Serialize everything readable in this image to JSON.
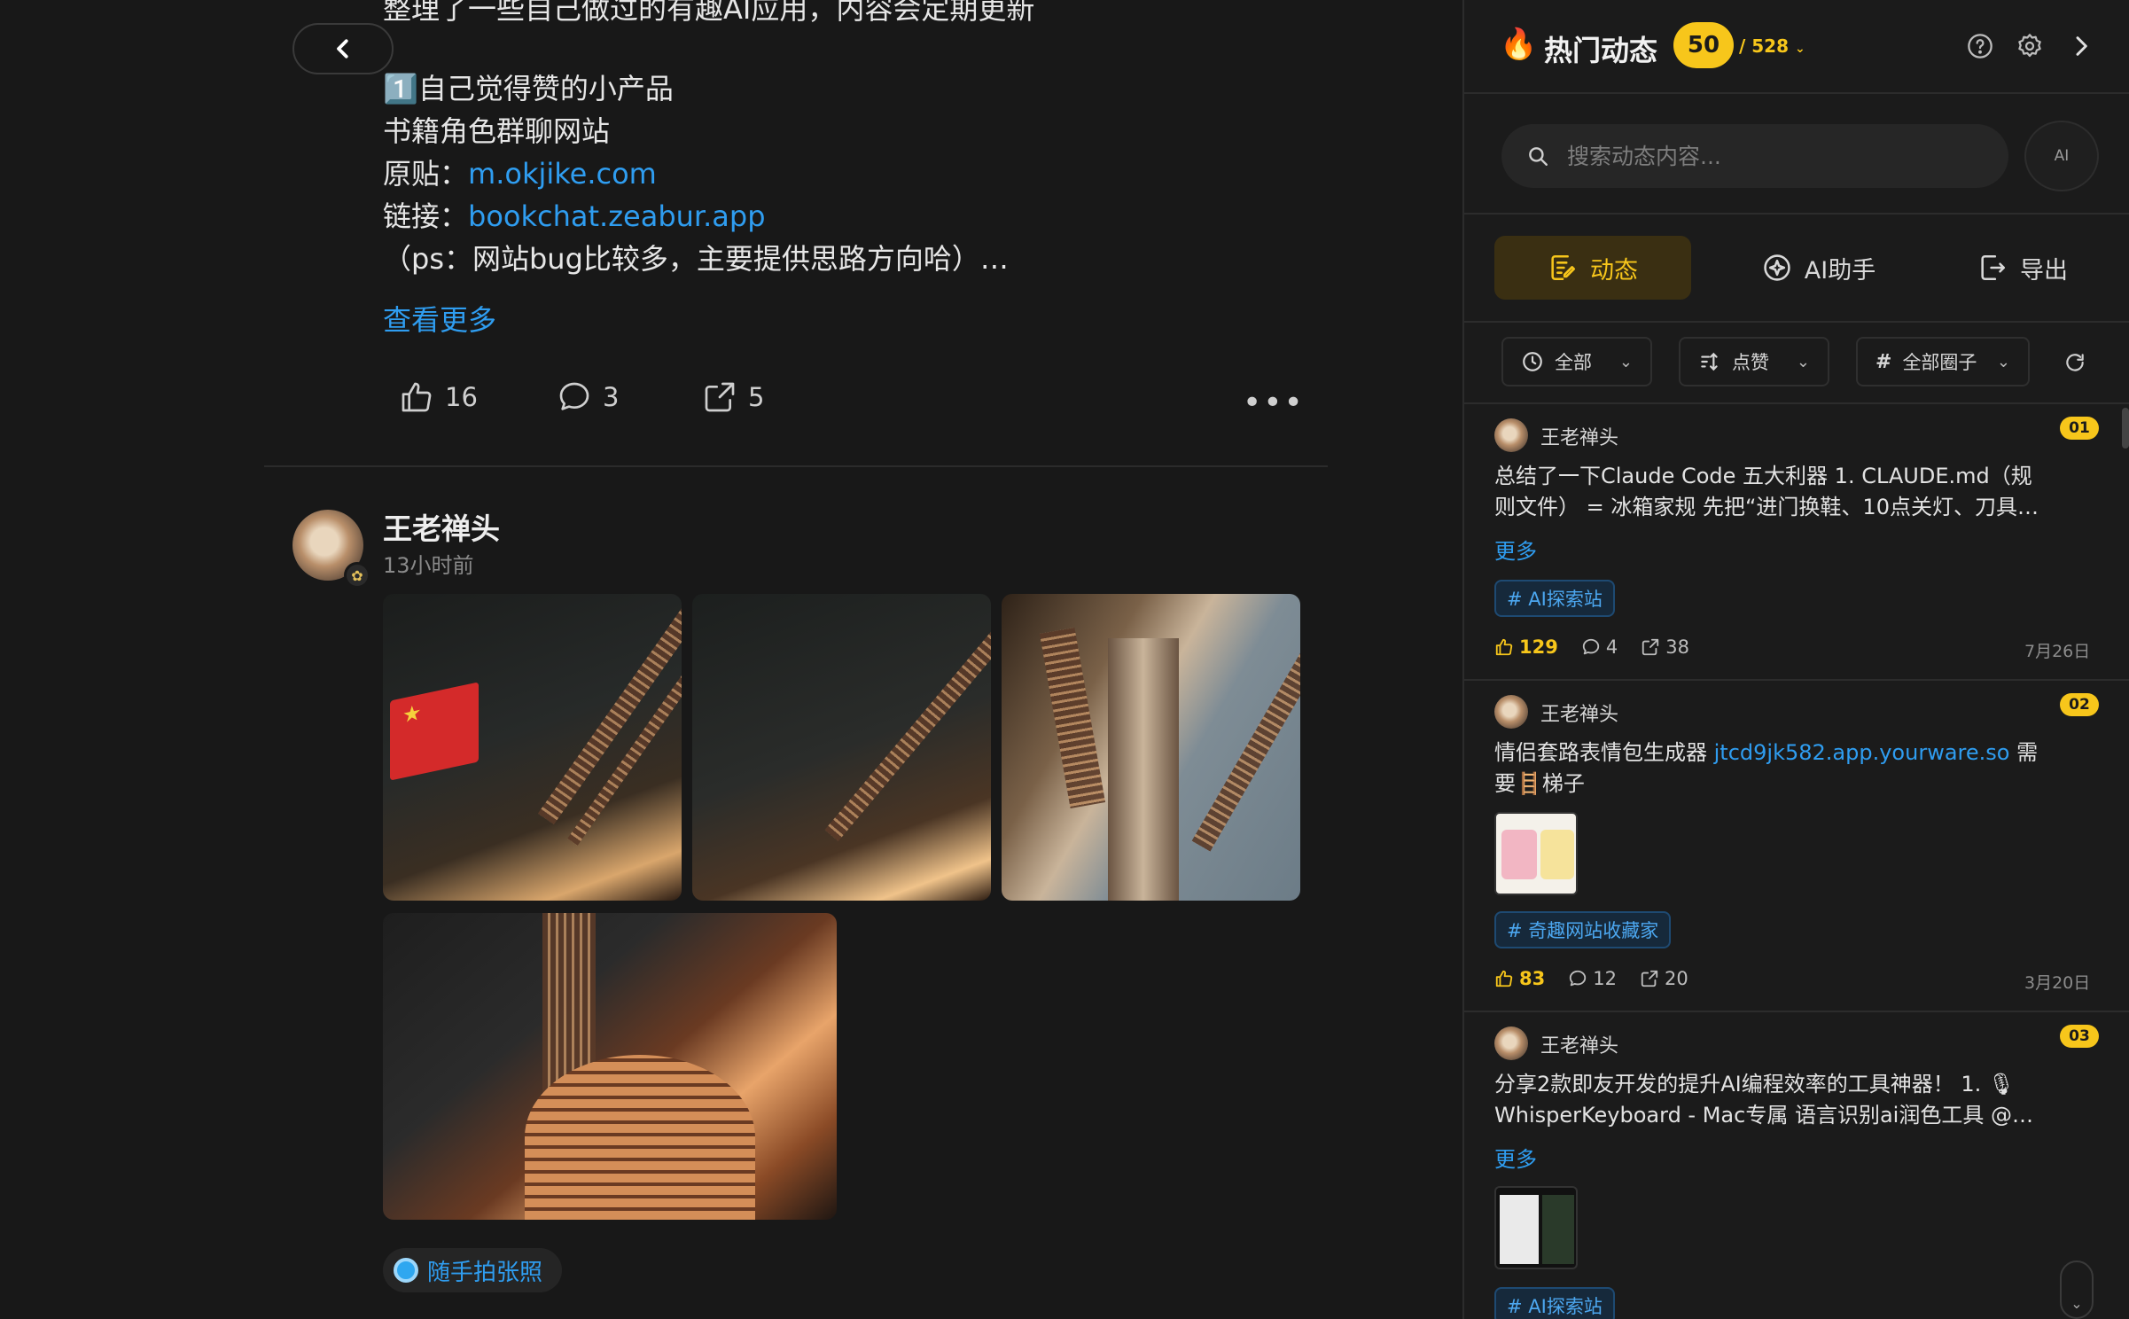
{
  "feed": {
    "intro_line": "整理了一些自己做过的有趣AI应用，内容会定期更新",
    "section_heading": "1️⃣自己觉得赞的小产品",
    "product_name": "书籍角色群聊网站",
    "origin_label": "原贴：",
    "origin_link": "m.okjike.com",
    "link_label": "链接：",
    "link_url": "bookchat.zeabur.app",
    "note": "（ps：网站bug比较多，主要提供思路方向哈）…",
    "see_more": "查看更多",
    "actions": {
      "likes": "16",
      "comments": "3",
      "shares": "5"
    },
    "post2": {
      "author": "王老禅头",
      "time": "13小时前",
      "topic": "随手拍张照"
    }
  },
  "panel": {
    "title": "热门动态",
    "count": "50",
    "total": "/ 528",
    "search": {
      "placeholder": "搜索动态内容..."
    },
    "ai_button": "AI",
    "tabs": [
      {
        "label": "动态",
        "active": true
      },
      {
        "label": "AI助手",
        "active": false
      },
      {
        "label": "导出",
        "active": false
      }
    ],
    "filters": {
      "time": "全部",
      "sort": "点赞",
      "circle": "全部圈子"
    },
    "items": [
      {
        "rank": "01",
        "author": "王老禅头",
        "text_line1": "总结了一下Claude Code 五大利器 1. CLAUDE.md（规",
        "text_line2": "则文件） = 冰箱家规 先把“进门换鞋、10点关灯、刀具…",
        "more": "更多",
        "tag": "# AI探索站",
        "likes": "129",
        "comments": "4",
        "shares": "38",
        "date": "7月26日"
      },
      {
        "rank": "02",
        "author": "王老禅头",
        "text_prefix": "情侣套路表情包生成器 ",
        "text_link": "jtcd9jk582.app.yourware.so",
        "text_suffix": " 需",
        "text_line2": "要🪜梯子",
        "tag": "# 奇趣网站收藏家",
        "likes": "83",
        "comments": "12",
        "shares": "20",
        "date": "3月20日"
      },
      {
        "rank": "03",
        "author": "王老禅头",
        "text_line1": "分享2款即友开发的提升AI编程效率的工具神器！ 1. 🎙",
        "text_line2": "WhisperKeyboard - Mac专属 语言识别ai润色工具 @…",
        "more": "更多",
        "tag": "# AI探索站"
      }
    ]
  },
  "colors": {
    "accent": "#f7c61b",
    "link": "#2f9df0",
    "background": "#181818"
  }
}
